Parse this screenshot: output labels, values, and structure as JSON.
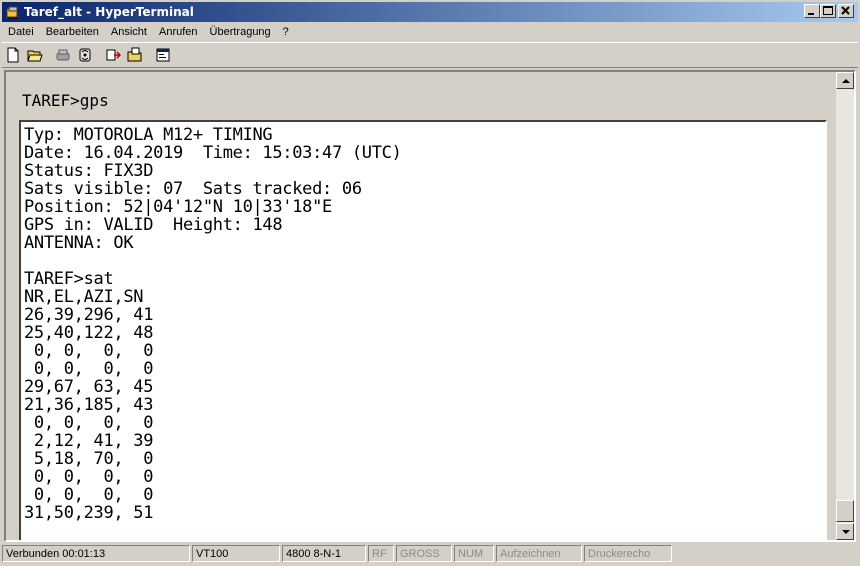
{
  "window": {
    "title": "Taref_alt - HyperTerminal",
    "controls": {
      "minimize": "_",
      "maximize": "□",
      "close": "×"
    }
  },
  "menu": [
    "Datei",
    "Bearbeiten",
    "Ansicht",
    "Anrufen",
    "Übertragung",
    "?"
  ],
  "toolbar": {
    "icons": [
      "new-connection-icon",
      "open-icon",
      "disconnect-icon",
      "dial-icon",
      "send-icon",
      "receive-icon",
      "properties-icon"
    ]
  },
  "terminal": {
    "previous_line": "TAREF>gps",
    "lines": [
      "Typ: MOTOROLA M12+ TIMING",
      "Date: 16.04.2019  Time: 15:03:47 (UTC)",
      "Status: FIX3D",
      "Sats visible: 07  Sats tracked: 06",
      "Position: 52|04'12\"N 10|33'18\"E",
      "GPS in: VALID  Height: 148",
      "ANTENNA: OK",
      "",
      "TAREF>sat",
      "NR,EL,AZI,SN",
      "26,39,296, 41",
      "25,40,122, 48",
      " 0, 0,  0,  0",
      " 0, 0,  0,  0",
      "29,67, 63, 45",
      "21,36,185, 43",
      " 0, 0,  0,  0",
      " 2,12, 41, 39",
      " 5,18, 70,  0",
      " 0, 0,  0,  0",
      " 0, 0,  0,  0",
      "31,50,239, 51"
    ]
  },
  "status": {
    "connected": "Verbunden 00:01:13",
    "emulation": "VT100",
    "settings": "4800 8-N-1",
    "rf": "RF",
    "caps": "GROSS",
    "num": "NUM",
    "capture": "Aufzeichnen",
    "print_echo": "Druckerecho"
  }
}
